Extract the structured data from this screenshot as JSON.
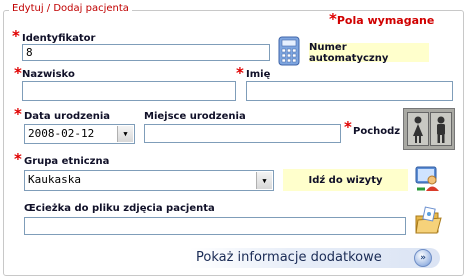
{
  "form": {
    "title": "Edytuj / Dodaj pacjenta",
    "required_note": "Pola wymagane",
    "required_marker": "*"
  },
  "identyfikator": {
    "label": "Identyfikator",
    "value": "8",
    "auto_label": "Numer automatyczny",
    "icon": "calculator-icon"
  },
  "nazwisko": {
    "label": "Nazwisko",
    "value": ""
  },
  "imie": {
    "label": "Imię",
    "value": ""
  },
  "data_urodzenia": {
    "label": "Data urodzenia",
    "value": "2008-02-12"
  },
  "miejsce_urodzenia": {
    "label": "Miejsce urodzenia",
    "value": ""
  },
  "pochodz": {
    "label": "Pochodz",
    "icons": [
      "female-person-icon",
      "male-person-icon"
    ]
  },
  "grupa_etniczna": {
    "label": "Grupa etniczna",
    "value": "Kaukaska"
  },
  "visit": {
    "label": "Idź do wizyty",
    "icon": "visit-icon"
  },
  "photo_path": {
    "label": "Œcieżka do pliku zdjęcia pacjenta",
    "value": "",
    "icon": "open-folder-icon"
  },
  "more_info": {
    "label": "Pokaż informacje dodatkowe",
    "icon": "double-chevron-right-icon"
  }
}
